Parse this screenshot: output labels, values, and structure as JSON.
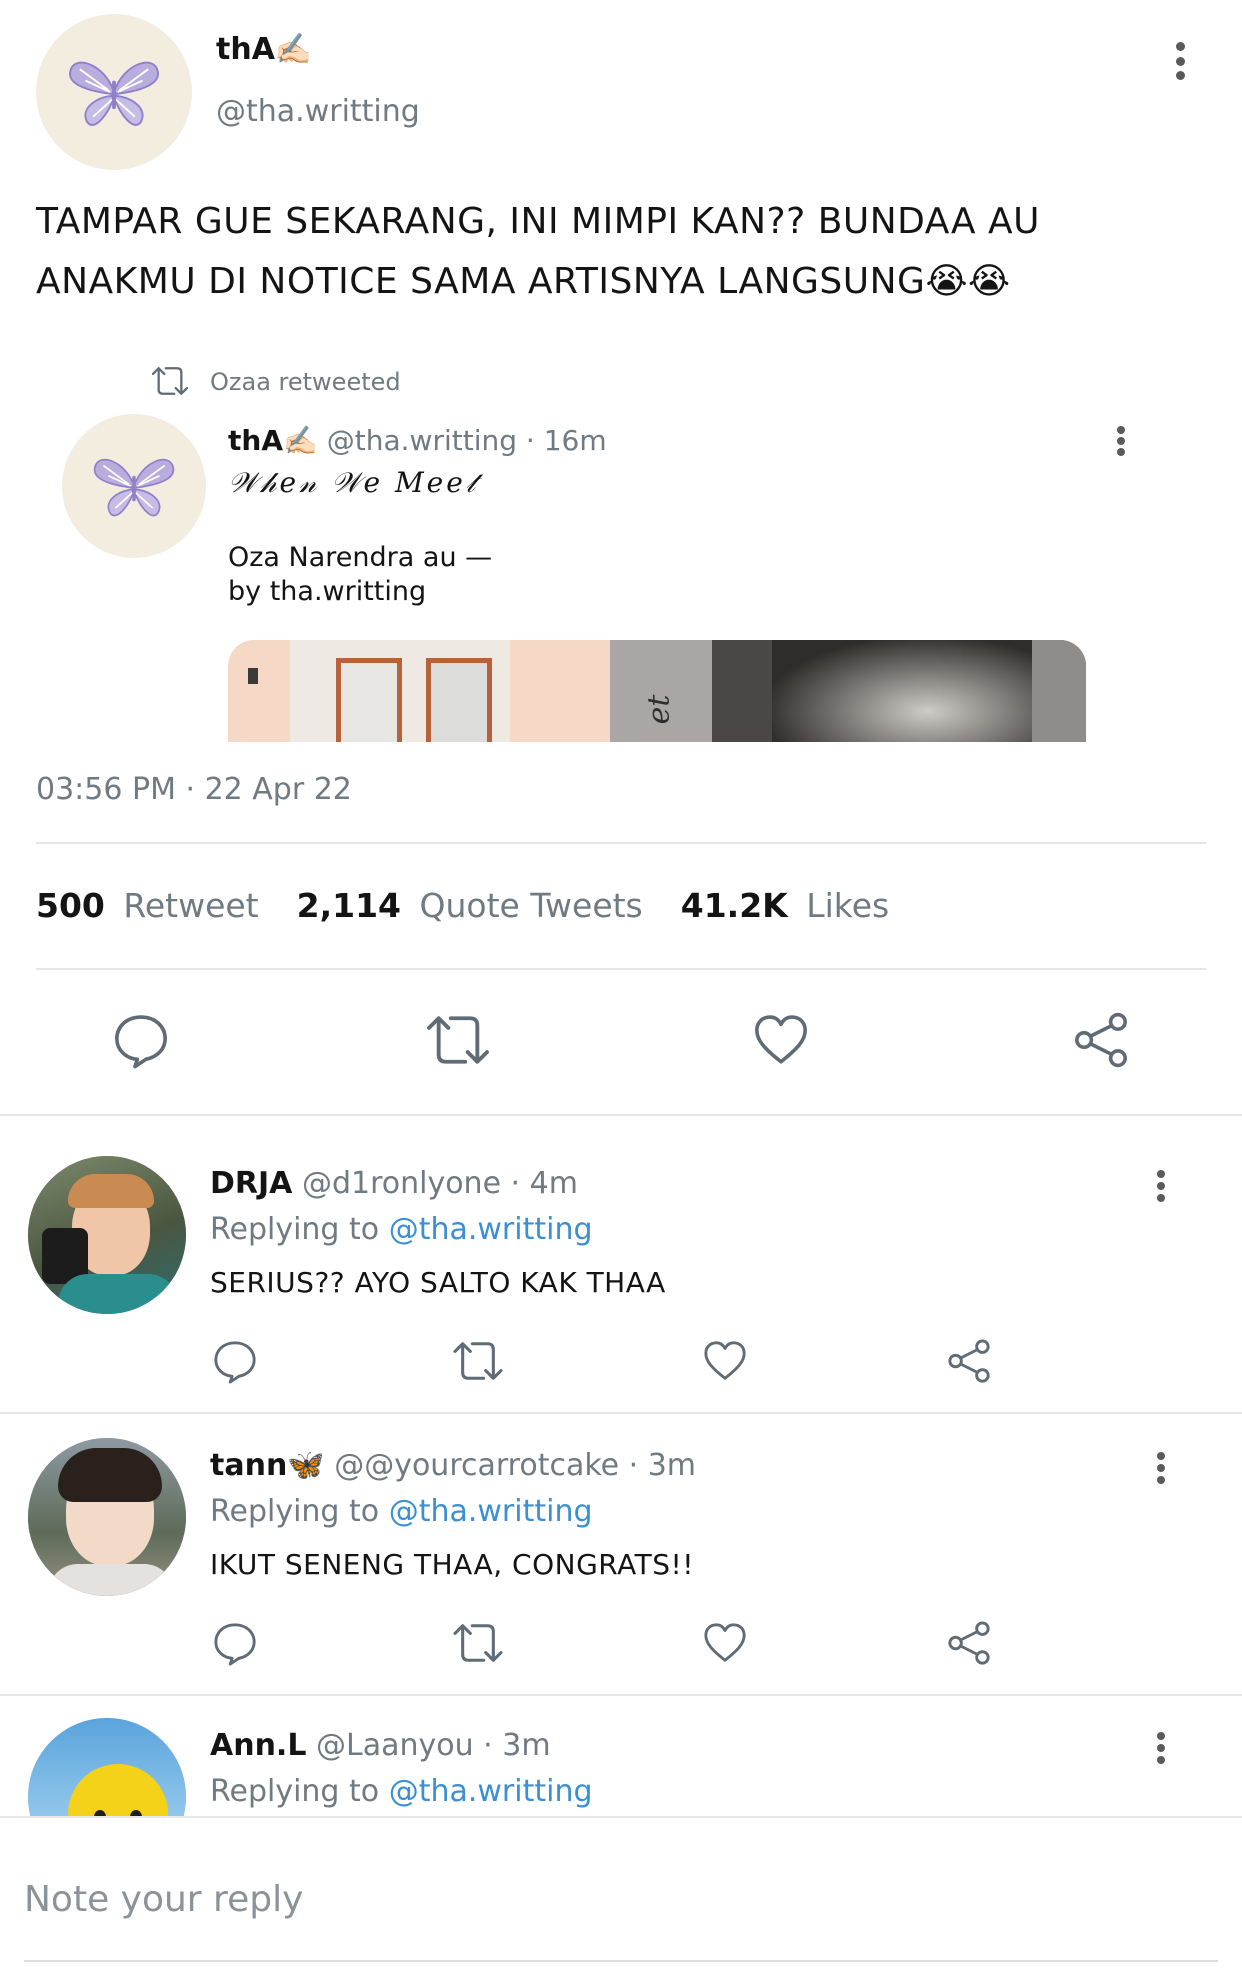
{
  "post": {
    "display_name": "thA✍🏻",
    "handle": "@tha.writting",
    "text": "TAMPAR GUE SEKARANG, INI MIMPI KAN?? BUNDAA AU ANAKMU DI NOTICE SAMA ARTISNYA LANGSUNG😭😭",
    "timestamp": "03:56 PM · 22 Apr 22"
  },
  "quoted": {
    "retweet_label": "Ozaa retweeted",
    "display_name": "thA✍🏻",
    "handle_time": "@tha.writting · 16m",
    "title": "𝒲𝒽𝑒𝓃 𝒲𝑒 𝑀𝑒𝑒𝓉",
    "line1": "Oza Narendra au —",
    "line2": "by tha.writting",
    "image_text": "et"
  },
  "stats": {
    "retweets_count": "500",
    "retweets_label": "Retweet",
    "quotes_count": "2,114",
    "quotes_label": "Quote Tweets",
    "likes_count": "41.2K",
    "likes_label": "Likes"
  },
  "replies": [
    {
      "display_name": "DRJA",
      "handle_time": "@d1ronlyone · 4m",
      "replying_label": "Replying to",
      "replying_handle": "@tha.writting",
      "text": "SERIUS?? AYO SALTO KAK THAA"
    },
    {
      "display_name": "tann🦋",
      "handle_time": "@@yourcarrotcake · 3m",
      "replying_label": "Replying to",
      "replying_handle": "@tha.writting",
      "text": "IKUT SENENG THAA, CONGRATS!!"
    },
    {
      "display_name": "Ann.L",
      "handle_time": "@Laanyou · 3m",
      "replying_label": "Replying to",
      "replying_handle": "@tha.writting"
    }
  ],
  "composer": {
    "placeholder": "Note your reply"
  },
  "colors": {
    "link": "#3b8fd4",
    "muted": "#707a82",
    "avatar_bg": "#f3ede0",
    "butterfly": "#a99bd6"
  },
  "icons": [
    "kebab-icon",
    "butterfly-icon",
    "retweet-icon",
    "comment-icon",
    "heart-icon",
    "share-icon"
  ]
}
